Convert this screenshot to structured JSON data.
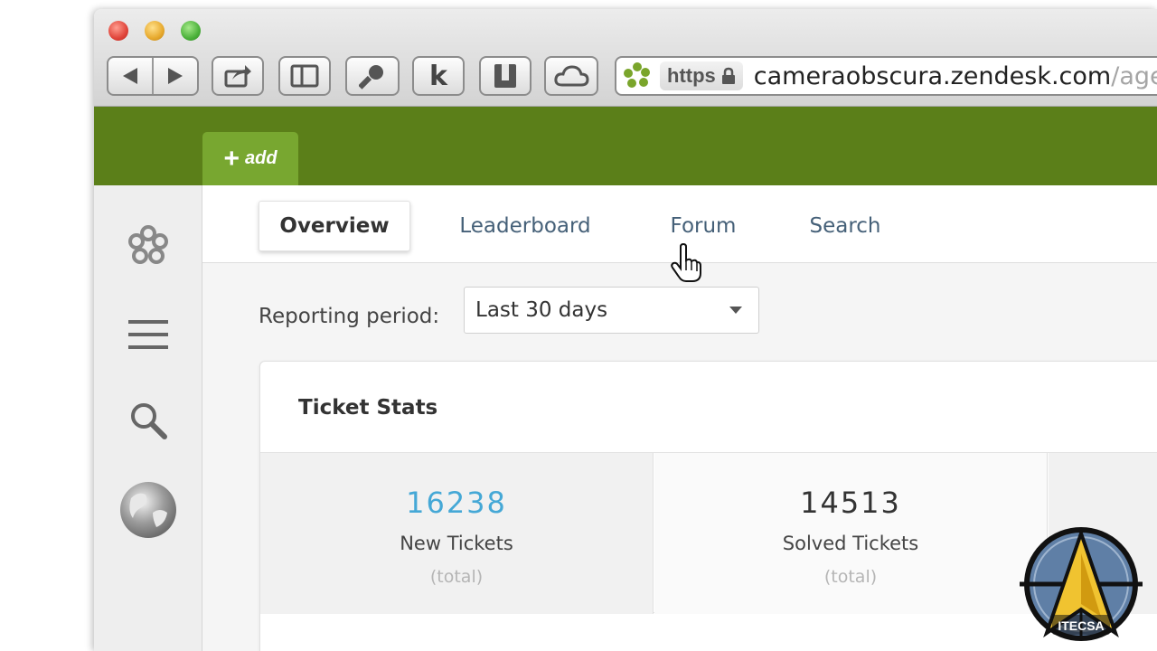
{
  "browser": {
    "url_scheme": "https",
    "url_host": "cameraobscura.zendesk.com",
    "url_path": "/age",
    "toolbar_k_label": "k"
  },
  "app": {
    "add_label": "add",
    "colors": {
      "header_green": "#5b7f19",
      "add_tab_green": "#78a730",
      "link_blue": "#45a8d6"
    },
    "tabs": [
      {
        "label": "Overview",
        "active": true
      },
      {
        "label": "Leaderboard",
        "active": false
      },
      {
        "label": "Forum",
        "active": false
      },
      {
        "label": "Search",
        "active": false
      }
    ],
    "reporting": {
      "label": "Reporting period:",
      "selected": "Last 30 days"
    },
    "ticket_stats": {
      "title": "Ticket Stats",
      "stats": [
        {
          "value": "16238",
          "label": "New Tickets",
          "sub": "(total)",
          "color": "#45a8d6"
        },
        {
          "value": "14513",
          "label": "Solved Tickets",
          "sub": "(total)",
          "color": "#333333"
        }
      ]
    }
  },
  "watermark": {
    "label": "ITECSA"
  }
}
